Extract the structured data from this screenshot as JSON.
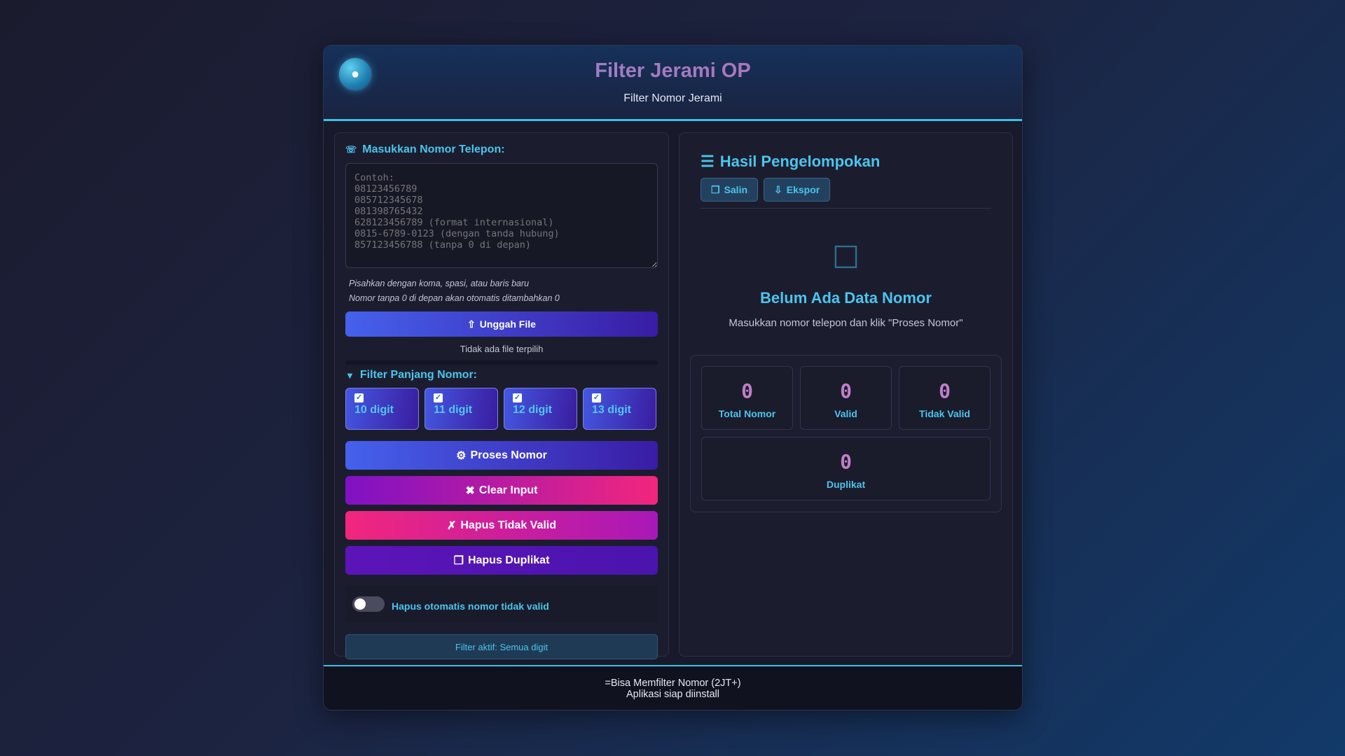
{
  "header": {
    "title": "Filter Jerami OP",
    "subtitle": "Filter Nomor Jerami",
    "logo_icon": "app-logo-icon"
  },
  "input": {
    "label": "Masukkan Nomor Telepon:",
    "placeholder": "Contoh:\n08123456789\n085712345678\n081398765432\n628123456789 (format internasional)\n0815-6789-0123 (dengan tanda hubung)\n857123456788 (tanpa 0 di depan)",
    "value": "",
    "hint1": "Pisahkan dengan koma, spasi, atau baris baru",
    "hint2": "Nomor tanpa 0 di depan akan otomatis ditambahkan 0"
  },
  "upload": {
    "button_label": "Unggah File",
    "status": "Tidak ada file terpilih"
  },
  "filter": {
    "label": "Filter Panjang Nomor:",
    "options": [
      {
        "label": "10 digit",
        "checked": true
      },
      {
        "label": "11 digit",
        "checked": true
      },
      {
        "label": "12 digit",
        "checked": true
      },
      {
        "label": "13 digit",
        "checked": true
      }
    ]
  },
  "actions": {
    "proses": "Proses Nomor",
    "clear": "Clear Input",
    "hapus_invalid": "Hapus Tidak Valid",
    "hapus_duplikat": "Hapus Duplikat"
  },
  "toggle": {
    "label": "Hapus otomatis nomor tidak valid",
    "on": false
  },
  "filter_status": "Filter aktif: Semua digit",
  "results": {
    "title": "Hasil Pengelompokan",
    "copy_label": "Salin",
    "export_label": "Ekspor",
    "empty_title": "Belum Ada Data Nomor",
    "empty_subtitle": "Masukkan nomor telepon dan klik \"Proses Nomor\""
  },
  "stats": {
    "total": {
      "value": "0",
      "label": "Total Nomor"
    },
    "valid": {
      "value": "0",
      "label": "Valid"
    },
    "invalid": {
      "value": "0",
      "label": "Tidak Valid"
    },
    "duplicate": {
      "value": "0",
      "label": "Duplikat"
    }
  },
  "footer": {
    "line1": "=Bisa Memfilter Nomor (2JT+)",
    "line2": "Aplikasi siap diinstall"
  },
  "colors": {
    "accent": "#4cc4ec",
    "primary_gradient_start": "#4561ec",
    "primary_gradient_end": "#3a1ca5",
    "stat_value": "#c07fc8"
  }
}
